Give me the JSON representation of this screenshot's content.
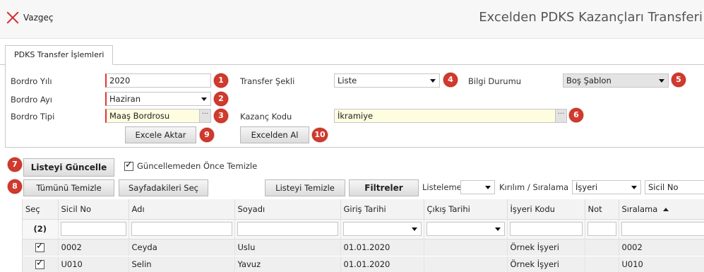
{
  "header": {
    "cancel_label": "Vazgeç",
    "title": "Excelden PDKS Kazançları Transferi"
  },
  "tab": {
    "label": "PDKS Transfer İşlemleri"
  },
  "form": {
    "bordro_yili": {
      "label": "Bordro Yılı",
      "value": "2020",
      "badge": "1"
    },
    "bordro_ayi": {
      "label": "Bordro Ayı",
      "value": "Haziran",
      "badge": "2"
    },
    "bordro_tipi": {
      "label": "Bordro Tipi",
      "value": "Maaş Bordrosu",
      "badge": "3"
    },
    "transfer_sekli": {
      "label": "Transfer Şekli",
      "value": "Liste",
      "badge": "4"
    },
    "bilgi_durumu": {
      "label": "Bilgi Durumu",
      "value": "Boş Şablon",
      "badge": "5"
    },
    "kazanc_kodu": {
      "label": "Kazanç Kodu",
      "value": "İkramiye",
      "badge": "6"
    },
    "dots": "···"
  },
  "buttons": {
    "excele_aktar": {
      "label": "Excele Aktar",
      "badge": "9"
    },
    "excelden_al": {
      "label": "Excelden Al",
      "badge": "10"
    },
    "listeyi_guncelle": {
      "label": "Listeyi Güncelle",
      "badge": "7"
    },
    "tumunu_temizle": {
      "label": "Tümünü Temizle",
      "badge": "8"
    },
    "sayfadakileri_sec": {
      "label": "Sayfadakileri Seç"
    },
    "listeyi_temizle": {
      "label": "Listeyi Temizle"
    },
    "filtreler": {
      "label": "Filtreler"
    }
  },
  "options": {
    "guncellemeden_once_temizle": "Güncellemeden Önce Temizle",
    "listeleme_label": "Listeleme",
    "listeleme_value": "",
    "kirilim_label": "Kırılım / Sıralama",
    "kirilim_value": "İşyeri",
    "sicil_no_value": "Sicil No"
  },
  "grid": {
    "columns": [
      "Seç",
      "Sicil No",
      "Adı",
      "Soyadı",
      "Giriş Tarihi",
      "Çıkış Tarihi",
      "İşyeri Kodu",
      "Not",
      "Sıralama"
    ],
    "count_label": "(2)",
    "rows": [
      {
        "checked": true,
        "sicil_no": "0002",
        "adi": "Ceyda",
        "soyadi": "Uslu",
        "giris": "01.01.2020",
        "cikis": "",
        "isyeri": "Örnek İşyeri",
        "not": "",
        "siralama": "0002"
      },
      {
        "checked": true,
        "sicil_no": "U010",
        "adi": "Selin",
        "soyadi": "Yavuz",
        "giris": "01.01.2020",
        "cikis": "",
        "isyeri": "Örnek İşyeri",
        "not": "",
        "siralama": "U010"
      }
    ]
  }
}
